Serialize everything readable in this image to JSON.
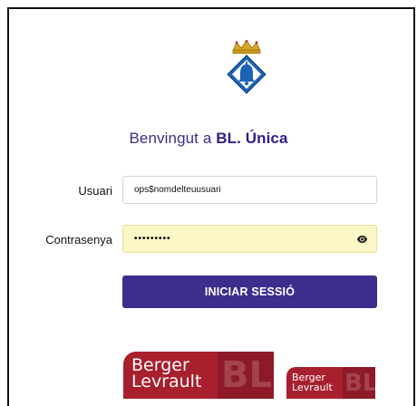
{
  "welcome": {
    "prefix": "Benvingut a ",
    "brand": "BL. Única"
  },
  "form": {
    "username_label": "Usuari",
    "username_value": "ops$nomdelteuusuari",
    "password_label": "Contrasenya",
    "password_masked": "•••••••••",
    "submit_label": "INICIAR SESSIÓ"
  },
  "icons": {
    "crest": "municipal-crest-bell-icon",
    "show_password": "eye-icon"
  },
  "logos": {
    "large": {
      "line1": "Berger",
      "line2": "Levrault",
      "mark": "BL"
    },
    "small": {
      "line1": "Berger",
      "line2": "Levrault",
      "mark": "BL"
    }
  },
  "colors": {
    "primary": "#3d2d8c",
    "autofill_bg": "#fbf6c5",
    "logo_red": "#a81f2e"
  }
}
